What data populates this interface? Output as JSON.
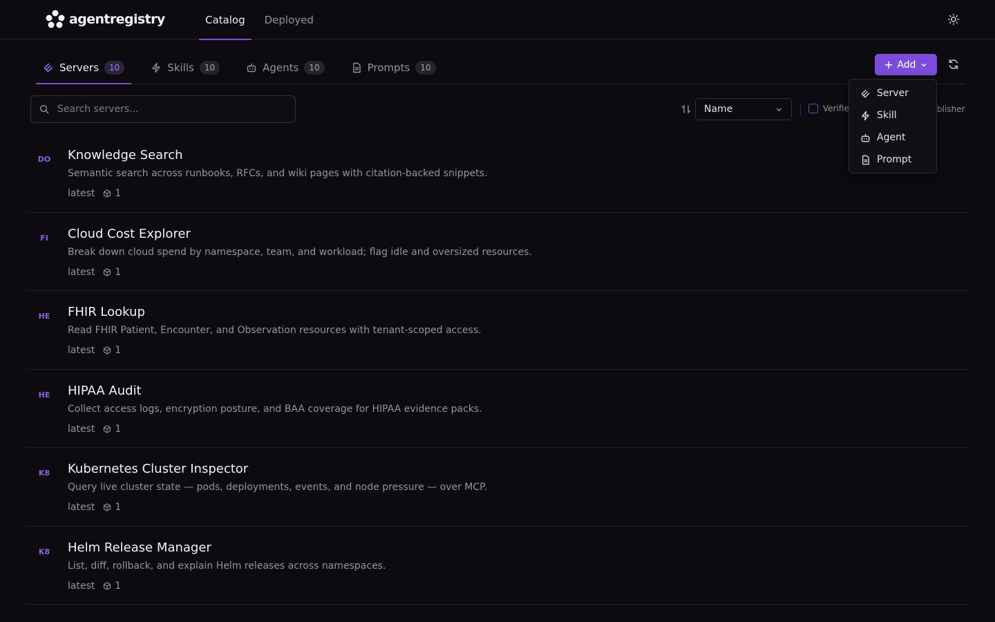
{
  "app": {
    "logo_text": "agentregistry",
    "nav": [
      {
        "label": "Catalog",
        "active": true
      },
      {
        "label": "Deployed",
        "active": false
      }
    ]
  },
  "tabs": [
    {
      "label": "Servers",
      "count": "10",
      "icon": "server-icon",
      "active": true
    },
    {
      "label": "Skills",
      "count": "10",
      "icon": "skill-icon",
      "active": false
    },
    {
      "label": "Agents",
      "count": "10",
      "icon": "agent-icon",
      "active": false
    },
    {
      "label": "Prompts",
      "count": "10",
      "icon": "prompt-icon",
      "active": false
    }
  ],
  "actions": {
    "add_label": "Add"
  },
  "add_menu": {
    "items": [
      {
        "label": "Server",
        "icon": "server-icon"
      },
      {
        "label": "Skill",
        "icon": "skill-icon"
      },
      {
        "label": "Agent",
        "icon": "agent-icon"
      },
      {
        "label": "Prompt",
        "icon": "prompt-icon"
      }
    ]
  },
  "search": {
    "placeholder": "Search servers...",
    "value": ""
  },
  "filters": {
    "sort_value": "Name",
    "verified_label": "Verifie",
    "publisher_label": "blisher"
  },
  "servers": [
    {
      "abbr": "DO",
      "title": "Knowledge Search",
      "description": "Semantic search across runbooks, RFCs, and wiki pages with citation-backed snippets.",
      "version": "latest",
      "count": "1"
    },
    {
      "abbr": "FI",
      "title": "Cloud Cost Explorer",
      "description": "Break down cloud spend by namespace, team, and workload; flag idle and oversized resources.",
      "version": "latest",
      "count": "1"
    },
    {
      "abbr": "HE",
      "title": "FHIR Lookup",
      "description": "Read FHIR Patient, Encounter, and Observation resources with tenant-scoped access.",
      "version": "latest",
      "count": "1"
    },
    {
      "abbr": "HE",
      "title": "HIPAA Audit",
      "description": "Collect access logs, encryption posture, and BAA coverage for HIPAA evidence packs.",
      "version": "latest",
      "count": "1"
    },
    {
      "abbr": "K8",
      "title": "Kubernetes Cluster Inspector",
      "description": "Query live cluster state — pods, deployments, events, and node pressure — over MCP.",
      "version": "latest",
      "count": "1"
    },
    {
      "abbr": "K8",
      "title": "Helm Release Manager",
      "description": "List, diff, rollback, and explain Helm releases across namespaces.",
      "version": "latest",
      "count": "1"
    }
  ],
  "colors": {
    "accent": "#7c4ddb",
    "background": "#0d0b10"
  }
}
